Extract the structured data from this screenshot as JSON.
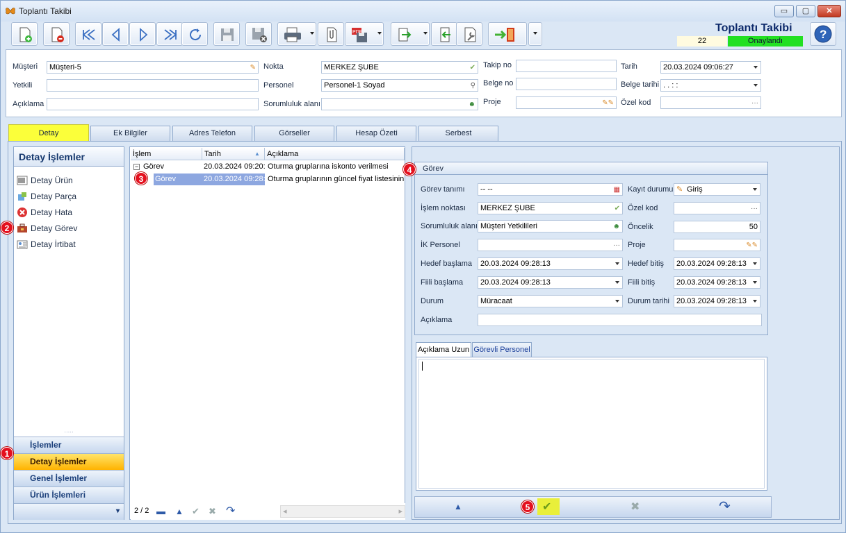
{
  "window": {
    "title": "Toplantı Takibi",
    "min": "▭",
    "max": "▢",
    "close": "✕"
  },
  "toolbar": {
    "app_title": "Toplantı Takibi",
    "doc_no": "22",
    "doc_status": "Onaylandı"
  },
  "header": {
    "musteri_label": "Müşteri",
    "musteri_value": "Müşteri-5",
    "yetkili_label": "Yetkili",
    "yetkili_value": "",
    "aciklama_label": "Açıklama",
    "aciklama_value": "",
    "nokta_label": "Nokta",
    "nokta_value": "MERKEZ ŞUBE",
    "personel_label": "Personel",
    "personel_value": "Personel-1 Soyad",
    "sorumluluk_label": "Sorumluluk alanı",
    "sorumluluk_value": "",
    "takipno_label": "Takip no",
    "takipno_value": "",
    "belgeno_label": "Belge no",
    "belgeno_value": "",
    "proje_label": "Proje",
    "proje_value": "",
    "tarih_label": "Tarih",
    "tarih_value": "20.03.2024 09:06:27",
    "belgetarihi_label": "Belge tarihi",
    "belgetarihi_value": " .  .        :  :",
    "ozelkod_label": "Özel kod",
    "ozelkod_value": "",
    "ellipsis": "···"
  },
  "tabs": [
    "Detay",
    "Ek Bilgiler",
    "Adres Telefon",
    "Görseller",
    "Hesap Özeti",
    "Serbest"
  ],
  "left": {
    "title": "Detay İşlemler",
    "items": [
      "Detay Ürün",
      "Detay Parça",
      "Detay Hata",
      "Detay Görev",
      "Detay İrtibat"
    ],
    "grip": "·····",
    "nav": [
      "İşlemler",
      "Detay İşlemler",
      "Genel İşlemler",
      "Ürün İşlemleri"
    ],
    "nav_more": "▾"
  },
  "grid": {
    "headers": [
      "İşlem",
      "Tarih",
      "Açıklama"
    ],
    "rows": [
      {
        "islem": "Görev",
        "tarih": "20.03.2024 09:20:",
        "aciklama": "Oturma gruplarına iskonto verilmesi",
        "expand": "−"
      },
      {
        "islem": "Görev",
        "tarih": "20.03.2024 09:28:",
        "aciklama": "Oturma gruplarının güncel fiyat listesinin ol"
      }
    ],
    "count": "2 / 2",
    "nav": {
      "first": "▬",
      "up": "▲",
      "ok": "✔",
      "cancel": "✖",
      "redo": "↷"
    },
    "scroll_left": "◂",
    "scroll_right": "▸"
  },
  "gorev": {
    "title": "Görev",
    "gorev_tanimi_label": "Görev tanımı",
    "gorev_tanimi_value": "-- --",
    "islem_noktasi_label": "İşlem noktası",
    "islem_noktasi_value": "MERKEZ ŞUBE",
    "sorumluluk_label": "Sorumluluk alanı",
    "sorumluluk_value": "Müşteri Yetkilileri",
    "ik_personel_label": "İK Personel",
    "ik_personel_value": "",
    "hedef_baslama_label": "Hedef başlama",
    "hedef_baslama_value": "20.03.2024 09:28:13",
    "fiili_baslama_label": "Fiili başlama",
    "fiili_baslama_value": "20.03.2024 09:28:13",
    "durum_label": "Durum",
    "durum_value": "Müracaat",
    "aciklama_label": "Açıklama",
    "aciklama_value": "",
    "kayit_durumu_label": "Kayıt durumu",
    "kayit_durumu_value": "Giriş",
    "ozel_kod_label": "Özel kod",
    "ozel_kod_value": "",
    "oncelik_label": "Öncelik",
    "oncelik_value": "50",
    "proje_label": "Proje",
    "proje_value": "",
    "hedef_bitis_label": "Hedef bitiş",
    "hedef_bitis_value": "20.03.2024 09:28:13",
    "fiili_bitis_label": "Fiili bitiş",
    "fiili_bitis_value": "20.03.2024 09:28:13",
    "durum_tarihi_label": "Durum tarihi",
    "durum_tarihi_value": "20.03.2024 09:28:13",
    "subtabs": [
      "Açıklama Uzun",
      "Görevli Personel"
    ],
    "nav": {
      "up": "▲",
      "ok": "✔",
      "cancel": "✖",
      "redo": "↷"
    }
  },
  "badges": [
    "1",
    "2",
    "3",
    "4",
    "5"
  ]
}
